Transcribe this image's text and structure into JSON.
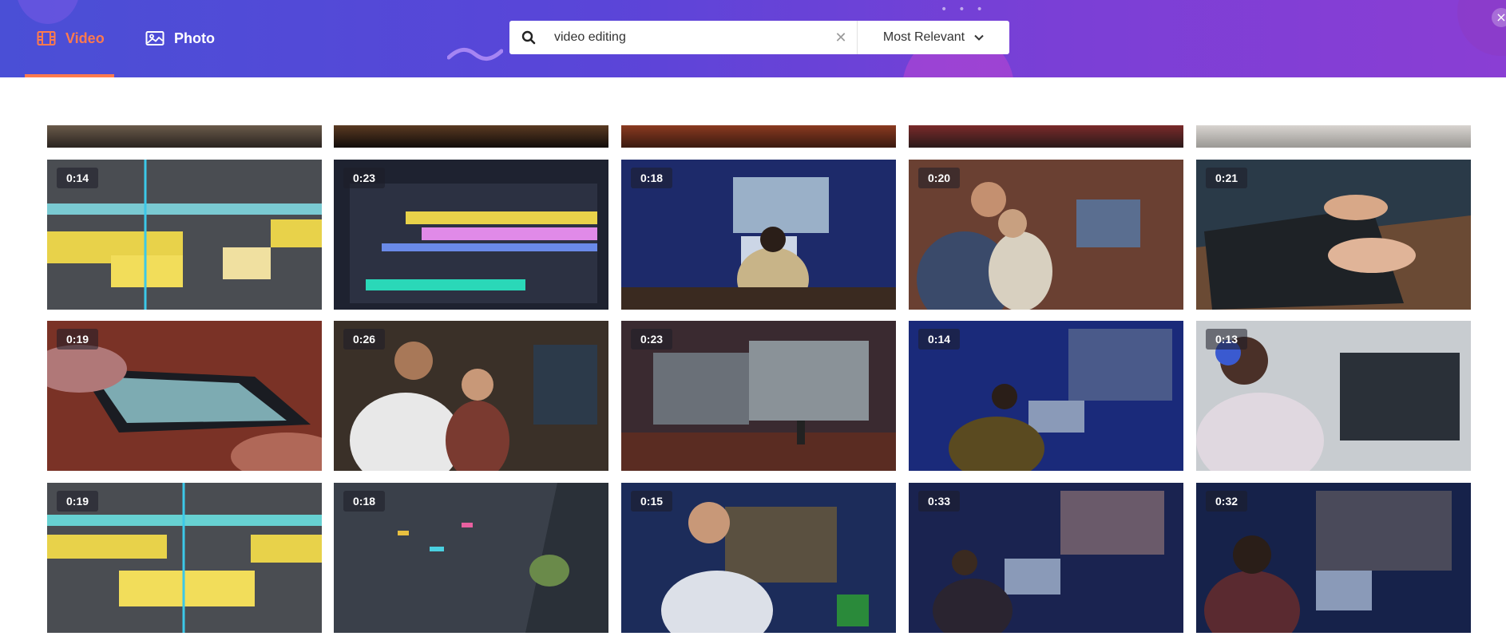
{
  "header": {
    "tabs": [
      {
        "label": "Video",
        "active": true
      },
      {
        "label": "Photo",
        "active": false
      }
    ],
    "search": {
      "value": "video editing",
      "placeholder": ""
    },
    "sort": {
      "selected": "Most Relevant"
    },
    "colors": {
      "accent": "#ff7a4d",
      "header_start": "#4a4fd6",
      "header_end": "#8a3ed4"
    }
  },
  "results": {
    "partial_row": [
      "",
      "",
      "",
      "",
      ""
    ],
    "rows": [
      [
        "0:14",
        "0:23",
        "0:18",
        "0:20",
        "0:21"
      ],
      [
        "0:19",
        "0:26",
        "0:23",
        "0:14",
        "0:13"
      ],
      [
        "0:19",
        "0:18",
        "0:15",
        "0:33",
        "0:32"
      ]
    ]
  }
}
